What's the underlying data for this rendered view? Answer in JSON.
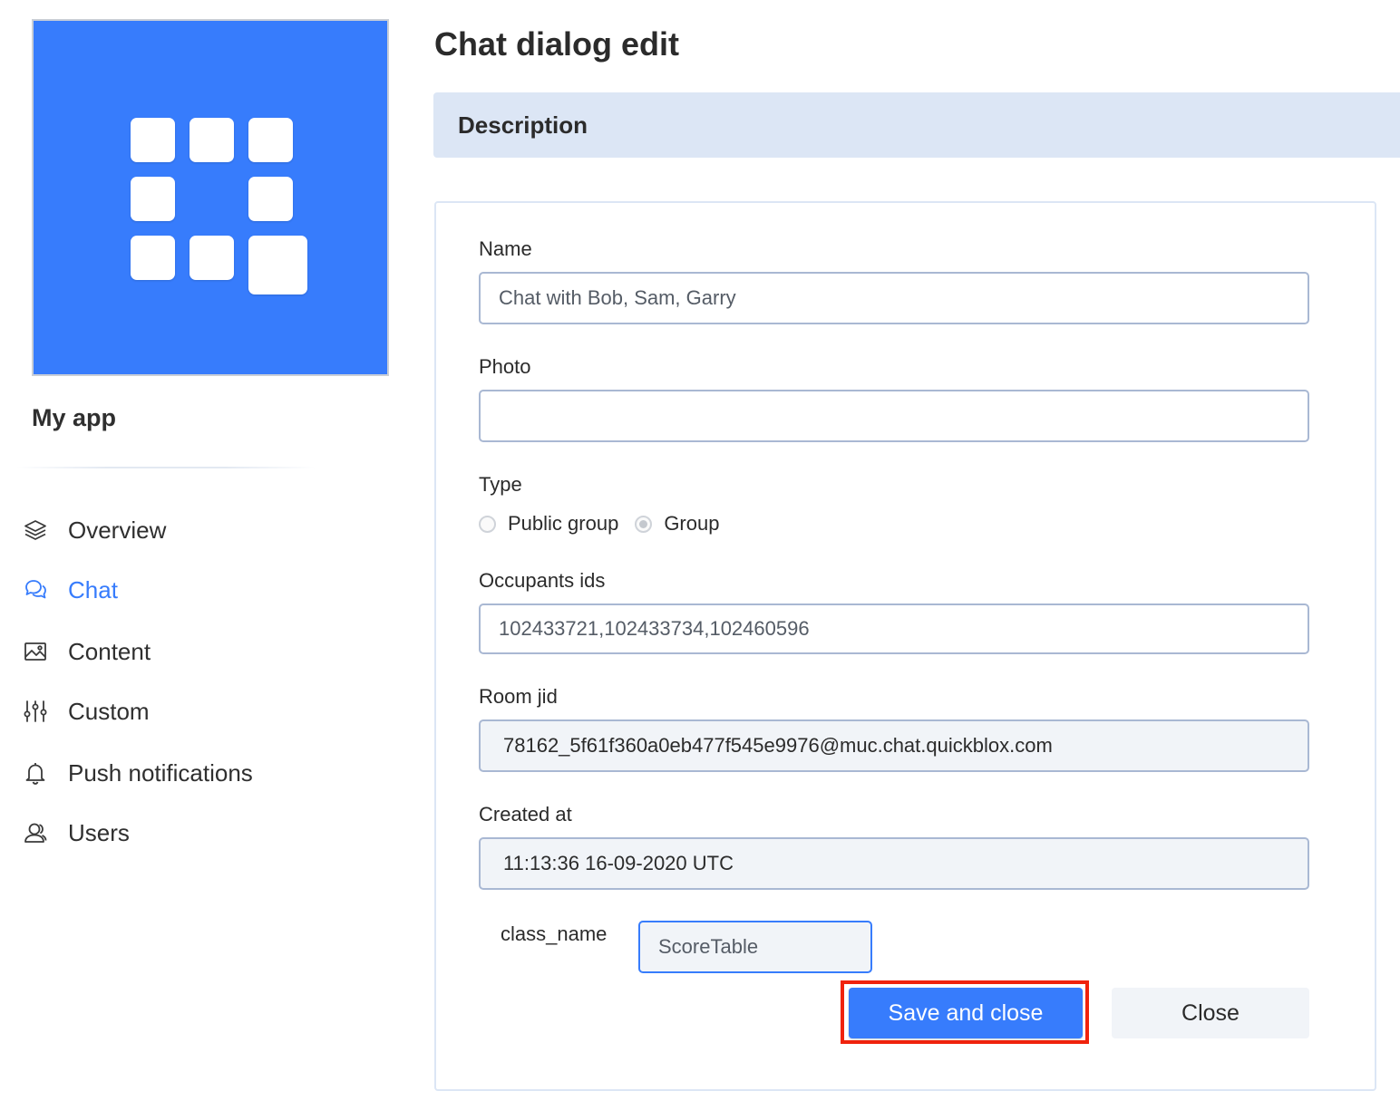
{
  "sidebar": {
    "app_name": "My app",
    "logo_color": "#377cfc",
    "items": [
      {
        "label": "Overview",
        "icon": "layers-icon",
        "active": false
      },
      {
        "label": "Chat",
        "icon": "chat-bubbles-icon",
        "active": true
      },
      {
        "label": "Content",
        "icon": "image-icon",
        "active": false
      },
      {
        "label": "Custom",
        "icon": "sliders-icon",
        "active": false
      },
      {
        "label": "Push notifications",
        "icon": "bell-icon",
        "active": false
      },
      {
        "label": "Users",
        "icon": "users-icon",
        "active": false
      }
    ]
  },
  "page": {
    "title": "Chat dialog edit",
    "section_title": "Description"
  },
  "form": {
    "name": {
      "label": "Name",
      "value": "Chat with Bob, Sam, Garry"
    },
    "photo": {
      "label": "Photo",
      "value": ""
    },
    "type": {
      "label": "Type",
      "options": [
        {
          "label": "Public group",
          "checked": false
        },
        {
          "label": "Group",
          "checked": true
        }
      ]
    },
    "occupants": {
      "label": "Occupants ids",
      "value": "102433721,102433734,102460596"
    },
    "room_jid": {
      "label": "Room jid",
      "value": "78162_5f61f360a0eb477f545e9976@muc.chat.quickblox.com"
    },
    "created_at": {
      "label": "Created at",
      "value": "11:13:36 16-09-2020 UTC"
    },
    "class_name": {
      "label": "class_name",
      "value": "ScoreTable"
    }
  },
  "actions": {
    "save_label": "Save and close",
    "close_label": "Close"
  },
  "colors": {
    "accent": "#377cfc",
    "section_bg": "#dce6f5",
    "highlight": "#f0220c"
  }
}
